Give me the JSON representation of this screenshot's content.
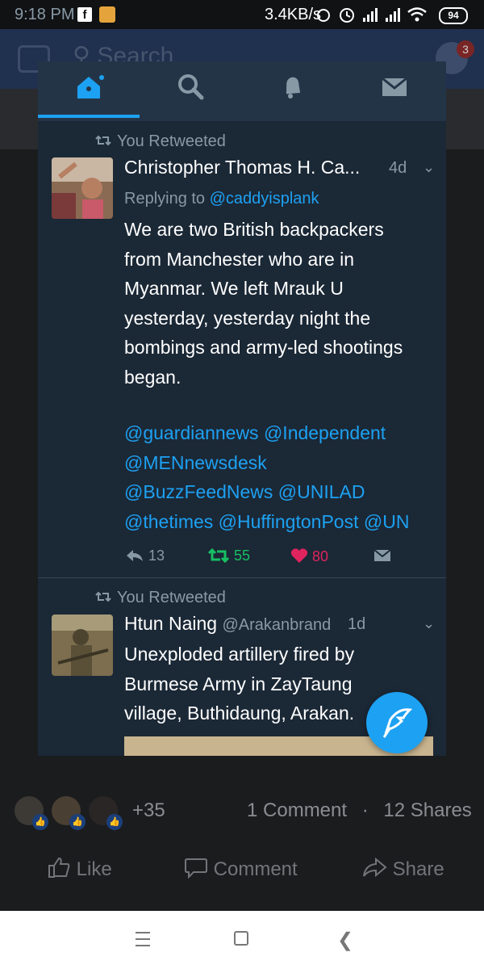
{
  "status_bar": {
    "time": "9:18 PM",
    "fb_icon": "f",
    "speed": "3.4KB/s",
    "battery": "94"
  },
  "background": {
    "search_placeholder": "Search",
    "messenger_badge": "3",
    "reactions_extra": "+35",
    "comments": "1 Comment",
    "dot": "·",
    "shares": "12 Shares",
    "actions": [
      "Like",
      "Comment",
      "Share"
    ]
  },
  "twitter": {
    "tabs": [
      "home-icon",
      "search-icon",
      "notifications-icon",
      "messages-icon"
    ],
    "accent": "#1da1f2",
    "tweets": [
      {
        "retweet_label": "You Retweeted",
        "author": "Christopher Thomas H. Ca...",
        "time": "4d",
        "replying_prefix": "Replying to",
        "replying_to": "@caddyisplank",
        "text": "We are two British backpackers from Manchester who are in Myanmar. We left Mrauk U yesterday, yesterday night the bombings and army-led shootings began.",
        "mentions": "@guardiannews @Independent @MENnewsdesk @BuzzFeedNews @UNILAD @thetimes @HuffingtonPost @UN",
        "replies": "13",
        "retweets": "55",
        "likes": "80"
      },
      {
        "retweet_label": "You Retweeted",
        "author": "Htun Naing",
        "handle": "@Arakanbrand",
        "time": "1d",
        "text": "Unexploded artillery fired by Burmese Army in ZayTaung village, Buthidaung, Arakan."
      }
    ]
  }
}
